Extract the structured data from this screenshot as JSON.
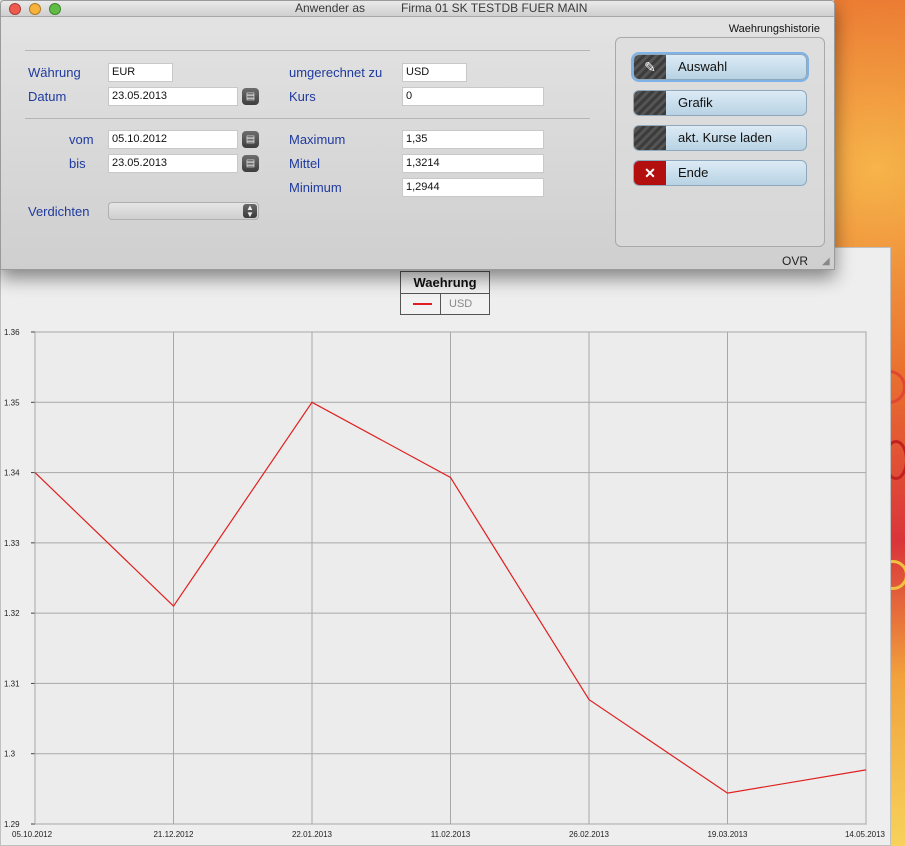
{
  "window": {
    "title_user": "Anwender as",
    "title_company": "Firma 01 SK TESTDB FUER MAIN"
  },
  "panel_heading": "Waehrungshistorie",
  "form": {
    "waehrung_label": "Währung",
    "waehrung_value": "EUR",
    "datum_label": "Datum",
    "datum_value": "23.05.2013",
    "umgerechnet_label": "umgerechnet zu",
    "umgerechnet_value": "USD",
    "kurs_label": "Kurs",
    "kurs_value": "0",
    "vom_label": "vom",
    "vom_value": "05.10.2012",
    "bis_label": "bis",
    "bis_value": "23.05.2013",
    "maximum_label": "Maximum",
    "maximum_value": "1,35",
    "mittel_label": "Mittel",
    "mittel_value": "1,3214",
    "minimum_label": "Minimum",
    "minimum_value": "1,2944",
    "verdichten_label": "Verdichten",
    "verdichten_value": ""
  },
  "buttons": {
    "auswahl": "Auswahl",
    "grafik": "Grafik",
    "kurse_laden": "akt. Kurse laden",
    "ende": "Ende",
    "ende_icon": "✕"
  },
  "status": {
    "mode": "OVR"
  },
  "colors": {
    "series": "#e02020",
    "label_blue": "#1f3a9e",
    "grid": "#a8a8a8"
  },
  "chart_data": {
    "type": "line",
    "title": "Waehrung",
    "series": [
      {
        "name": "USD",
        "x": [
          "05.10.2012",
          "21.12.2012",
          "22.01.2013",
          "11.02.2013",
          "26.02.2013",
          "19.03.2013",
          "14.05.2013"
        ],
        "values": [
          1.34,
          1.321,
          1.35,
          1.3393,
          1.3077,
          1.2944,
          1.2977
        ]
      }
    ],
    "ylim": [
      1.29,
      1.36
    ],
    "yticks": [
      "1.29",
      "1.3",
      "1.31",
      "1.32",
      "1.33",
      "1.34",
      "1.35",
      "1.36"
    ],
    "grid": true,
    "legend": "top-center"
  }
}
